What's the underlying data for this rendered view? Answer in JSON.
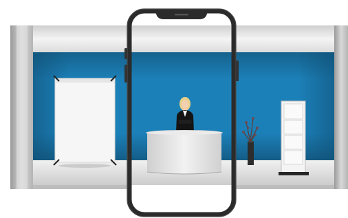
{
  "scene": {
    "colors": {
      "wall_top": "#1a6f9e",
      "wall_mid": "#1e85bf",
      "wall_bottom": "#156793",
      "frame_light": "#efefef",
      "frame_mid": "#d3d3d3",
      "frame_dark": "#9c9c9c",
      "phone_body": "#2a2a2a",
      "desk": "#e9e9e9"
    },
    "icons": [
      "phone-frame-icon",
      "poster-stand-icon",
      "reception-desk-icon",
      "person-icon",
      "plant-icon",
      "display-shelf-icon"
    ]
  }
}
